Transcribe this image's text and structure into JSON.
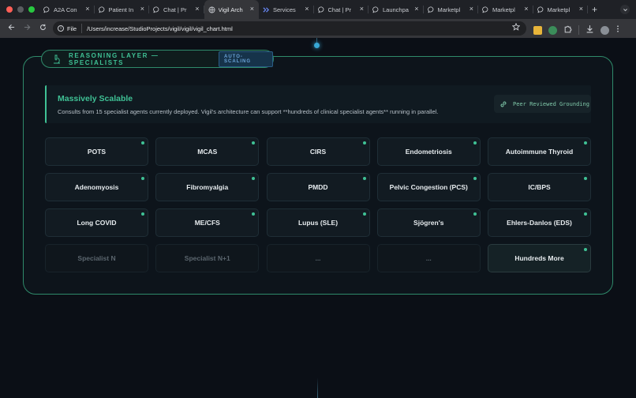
{
  "browser": {
    "tabs": [
      {
        "label": "A2A Con",
        "icon": "chat-bubble-icon",
        "active": false
      },
      {
        "label": "Patient In",
        "icon": "chat-bubble-icon",
        "active": false
      },
      {
        "label": "Chat | Pr",
        "icon": "chat-bubble-icon",
        "active": false
      },
      {
        "label": "Vigil Arch",
        "icon": "globe-icon",
        "active": true
      },
      {
        "label": "Services",
        "icon": "arrows-icon",
        "active": false
      },
      {
        "label": "Chat | Pr",
        "icon": "chat-bubble-icon",
        "active": false
      },
      {
        "label": "Launchpa",
        "icon": "chat-bubble-icon",
        "active": false
      },
      {
        "label": "Marketpl",
        "icon": "chat-bubble-icon",
        "active": false
      },
      {
        "label": "Marketpl",
        "icon": "chat-bubble-icon",
        "active": false
      },
      {
        "label": "Marketpl",
        "icon": "chat-bubble-icon",
        "active": false
      }
    ],
    "new_tab": "+",
    "close_glyph": "×",
    "url_chip": "File",
    "url": "/Users/increase/StudioProjects/vigil/vigil/vigil_chart.html"
  },
  "colors": {
    "accent_green": "#3fc195",
    "panel_border": "#2f8a6a",
    "badge_blue": "#6aa3d8",
    "node_blue": "#38a8d6"
  },
  "panel": {
    "title": "REASONING LAYER — SPECIALISTS",
    "badge": "AUTO-SCALING",
    "icon": "microscope-icon"
  },
  "banner": {
    "title": "Massively Scalable",
    "description": "Consults from 15 specialist agents currently deployed. Vigil's architecture can support **hundreds of clinical specialist agents** running in parallel."
  },
  "grounding": {
    "label": "Peer Reviewed Grounding",
    "icon": "link-icon"
  },
  "specialists": [
    {
      "label": "POTS",
      "kind": "active"
    },
    {
      "label": "MCAS",
      "kind": "active"
    },
    {
      "label": "CIRS",
      "kind": "active"
    },
    {
      "label": "Endometriosis",
      "kind": "active"
    },
    {
      "label": "Autoimmune Thyroid",
      "kind": "active"
    },
    {
      "label": "Adenomyosis",
      "kind": "active"
    },
    {
      "label": "Fibromyalgia",
      "kind": "active"
    },
    {
      "label": "PMDD",
      "kind": "active"
    },
    {
      "label": "Pelvic Congestion (PCS)",
      "kind": "active"
    },
    {
      "label": "IC/BPS",
      "kind": "active"
    },
    {
      "label": "Long COVID",
      "kind": "active"
    },
    {
      "label": "ME/CFS",
      "kind": "active"
    },
    {
      "label": "Lupus (SLE)",
      "kind": "active"
    },
    {
      "label": "Sjögren's",
      "kind": "active"
    },
    {
      "label": "Ehlers-Danlos (EDS)",
      "kind": "active"
    },
    {
      "label": "Specialist N",
      "kind": "ghost"
    },
    {
      "label": "Specialist N+1",
      "kind": "ghost"
    },
    {
      "label": "...",
      "kind": "ghost"
    },
    {
      "label": "...",
      "kind": "ghost"
    },
    {
      "label": "Hundreds More",
      "kind": "more"
    }
  ]
}
